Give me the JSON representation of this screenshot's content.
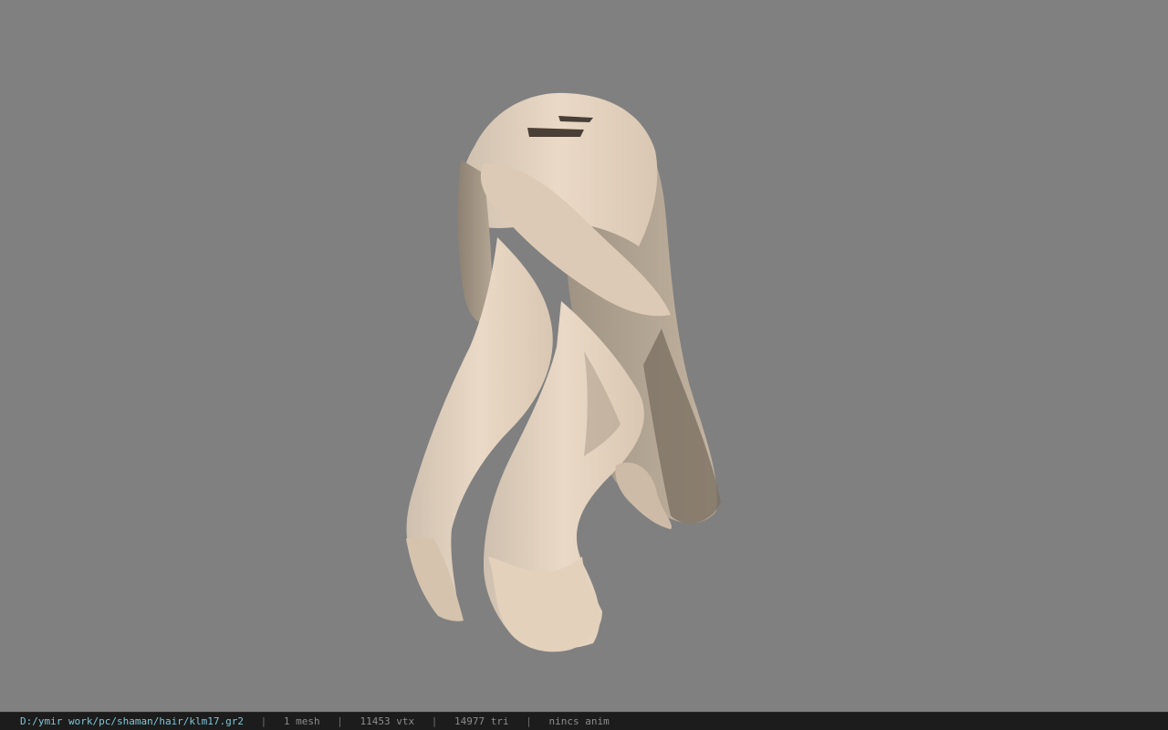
{
  "viewport": {
    "background": "#808080",
    "model_color": "#e6d4bf"
  },
  "statusbar": {
    "file_path": "D:/ymir work/pc/shaman/hair/klm17.gr2",
    "separator": "|",
    "mesh_count": "1 mesh",
    "vertex_count": "11453 vtx",
    "triangle_count": "14977 tri",
    "anim_status": "nincs anim",
    "path_color": "#7fc6d8"
  }
}
